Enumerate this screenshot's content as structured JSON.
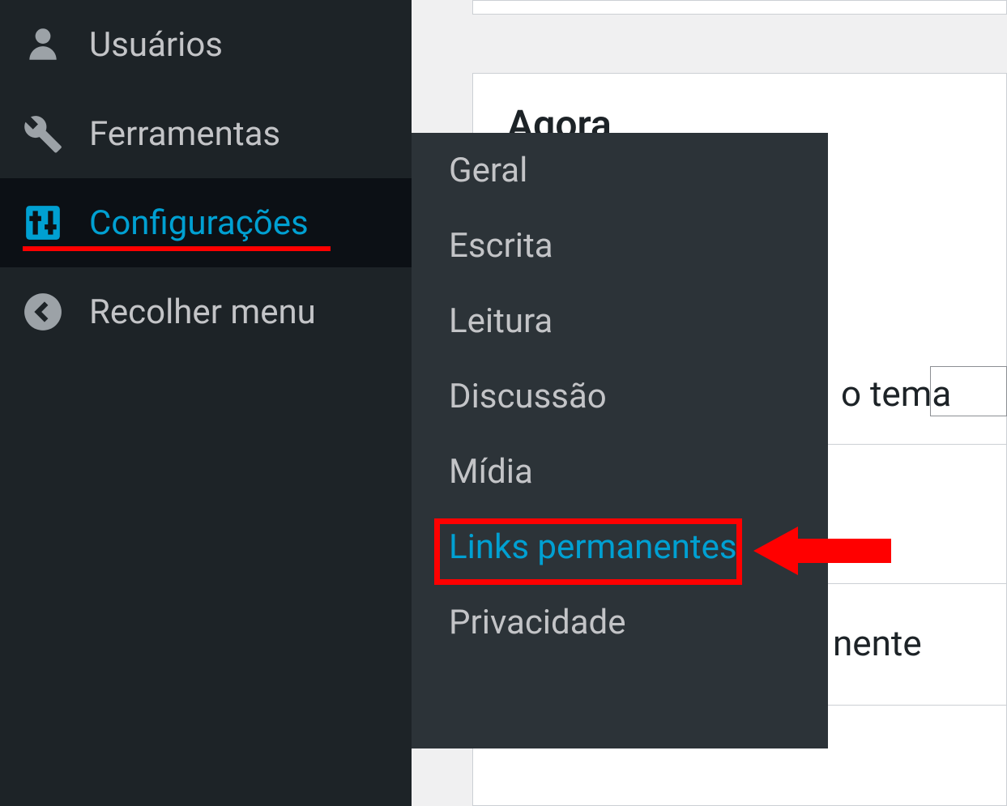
{
  "sidebar": {
    "items": [
      {
        "label": "Usuários",
        "icon": "users"
      },
      {
        "label": "Ferramentas",
        "icon": "wrench"
      },
      {
        "label": "Configurações",
        "icon": "sliders",
        "active": true
      },
      {
        "label": "Recolher menu",
        "icon": "collapse"
      }
    ]
  },
  "submenu": {
    "items": [
      {
        "label": "Geral"
      },
      {
        "label": "Escrita"
      },
      {
        "label": "Leitura"
      },
      {
        "label": "Discussão"
      },
      {
        "label": "Mídia"
      },
      {
        "label": "Links permanentes",
        "highlighted": true
      },
      {
        "label": "Privacidade"
      }
    ]
  },
  "content": {
    "dashboard_title": "Agora",
    "partial_text_1": "o tema",
    "partial_text_2": "nente"
  }
}
